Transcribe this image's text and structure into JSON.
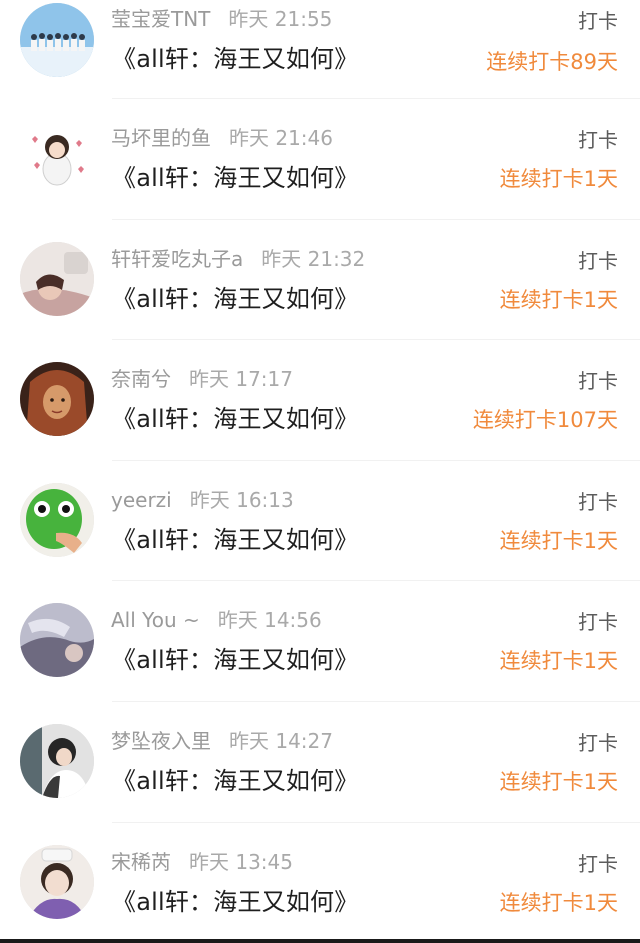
{
  "items": [
    {
      "name": "莹宝爱TNT",
      "time": "昨天 21:55",
      "title": "《all轩：海王又如何》",
      "action": "打卡",
      "streak": "连续打卡89天",
      "avatar_icon": "group-photo-avatar",
      "avatar_colors": [
        "#8fc4ea",
        "#e8f2fa"
      ]
    },
    {
      "name": "马坏里的鱼",
      "time": "昨天 21:46",
      "title": "《all轩：海王又如何》",
      "action": "打卡",
      "streak": "连续打卡1天",
      "avatar_icon": "cartoon-character-avatar",
      "avatar_colors": [
        "#ffffff",
        "#f4f4f4"
      ]
    },
    {
      "name": "轩轩爱吃丸子a",
      "time": "昨天 21:32",
      "title": "《all轩：海王又如何》",
      "action": "打卡",
      "streak": "连续打卡1天",
      "avatar_icon": "person-photo-avatar",
      "avatar_colors": [
        "#c7a3a0",
        "#ece6e3"
      ]
    },
    {
      "name": "奈南兮",
      "time": "昨天 17:17",
      "title": "《all轩：海王又如何》",
      "action": "打卡",
      "streak": "连续打卡107天",
      "avatar_icon": "person-photo-avatar",
      "avatar_colors": [
        "#6b3a2a",
        "#d69a6a"
      ]
    },
    {
      "name": "yeerzi",
      "time": "昨天 16:13",
      "title": "《all轩：海王又如何》",
      "action": "打卡",
      "streak": "连续打卡1天",
      "avatar_icon": "green-mask-avatar",
      "avatar_colors": [
        "#47b33d",
        "#f1efe9"
      ]
    },
    {
      "name": "All You ~",
      "time": "昨天 14:56",
      "title": "《all轩：海王又如何》",
      "action": "打卡",
      "streak": "连续打卡1天",
      "avatar_icon": "person-photo-avatar",
      "avatar_colors": [
        "#6e6a80",
        "#bcbccc"
      ]
    },
    {
      "name": "梦坠夜入里",
      "time": "昨天 14:27",
      "title": "《all轩：海王又如何》",
      "action": "打卡",
      "streak": "连续打卡1天",
      "avatar_icon": "person-photo-avatar",
      "avatar_colors": [
        "#262626",
        "#e2e2e2"
      ]
    },
    {
      "name": "宋稀芮",
      "time": "昨天 13:45",
      "title": "《all轩：海王又如何》",
      "action": "打卡",
      "streak": "连续打卡1天",
      "avatar_icon": "person-photo-avatar",
      "avatar_colors": [
        "#e5d3c6",
        "#7f5fb0"
      ]
    }
  ],
  "colors": {
    "streak": "#f08a3c",
    "meta": "#9a9a9a",
    "title": "#1f1f1f",
    "action": "#5c5c5c"
  }
}
